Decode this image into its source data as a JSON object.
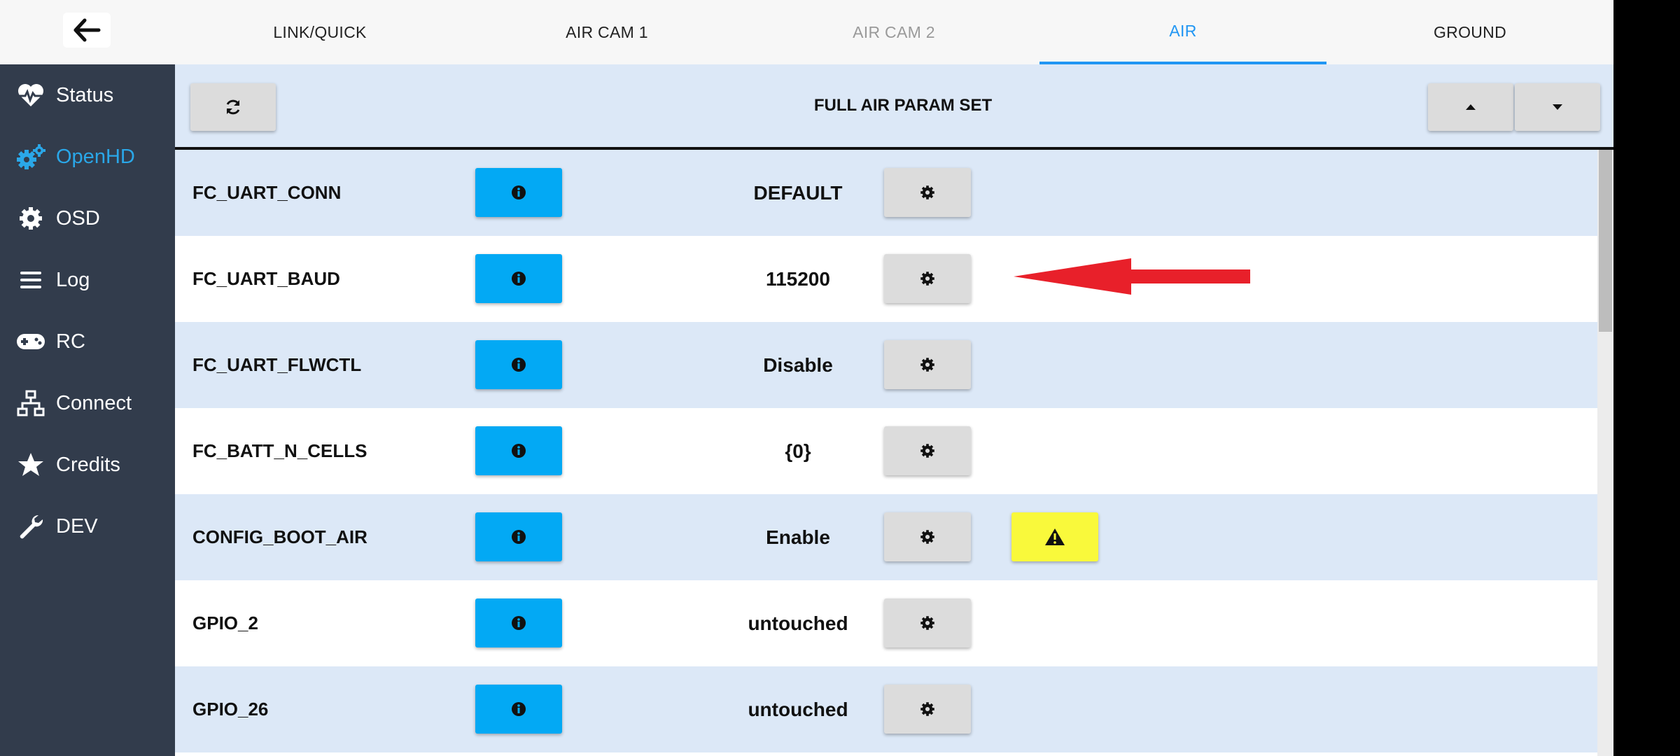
{
  "tabs": [
    {
      "label": "LINK/QUICK"
    },
    {
      "label": "AIR CAM 1"
    },
    {
      "label": "AIR CAM 2"
    },
    {
      "label": "AIR"
    },
    {
      "label": "GROUND"
    }
  ],
  "active_tab": "AIR",
  "disabled_tab": "AIR CAM 2",
  "sidebar": {
    "items": [
      {
        "label": "Status",
        "icon": "heartbeat-icon"
      },
      {
        "label": "OpenHD",
        "icon": "gears-icon"
      },
      {
        "label": "OSD",
        "icon": "gear-icon"
      },
      {
        "label": "Log",
        "icon": "menu-lines-icon"
      },
      {
        "label": "RC",
        "icon": "gamepad-icon"
      },
      {
        "label": "Connect",
        "icon": "network-icon"
      },
      {
        "label": "Credits",
        "icon": "star-icon"
      },
      {
        "label": "DEV",
        "icon": "wrench-icon"
      }
    ],
    "active_item": "OpenHD"
  },
  "header": {
    "title": "FULL AIR PARAM SET"
  },
  "params": [
    {
      "name": "FC_UART_CONN",
      "value": "DEFAULT"
    },
    {
      "name": "FC_UART_BAUD",
      "value": "115200"
    },
    {
      "name": "FC_UART_FLWCTL",
      "value": "Disable"
    },
    {
      "name": "FC_BATT_N_CELLS",
      "value": "{0}"
    },
    {
      "name": "CONFIG_BOOT_AIR",
      "value": "Enable",
      "warning": true
    },
    {
      "name": "GPIO_2",
      "value": "untouched"
    },
    {
      "name": "GPIO_26",
      "value": "untouched"
    }
  ],
  "colors": {
    "accent": "#2196f3",
    "sidebar_bg": "#323c4c",
    "row_shade": "#dce8f7",
    "info_button": "#03a9f4",
    "warning_button": "#f9f93b",
    "annotation_arrow": "#e8202a"
  }
}
